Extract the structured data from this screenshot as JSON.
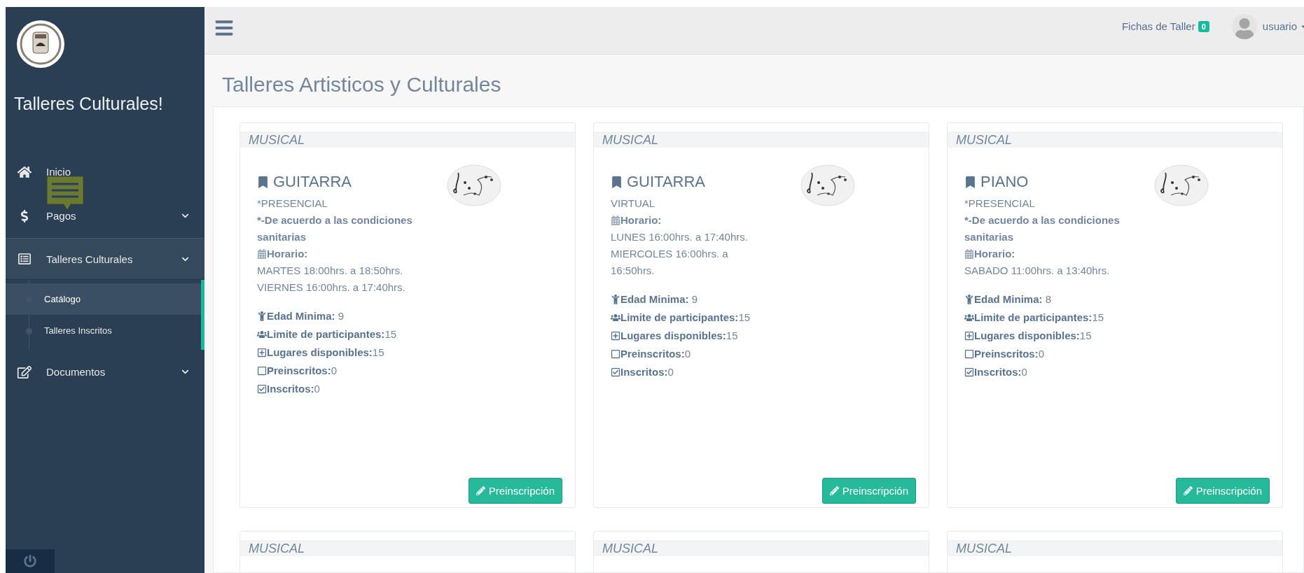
{
  "sidebar": {
    "brand": "Talleres Culturales!",
    "items": [
      {
        "kind": "link",
        "label": "Inicio",
        "expanded": false
      },
      {
        "kind": "menu",
        "label": "Pagos",
        "expanded": false,
        "tooltip": true
      },
      {
        "kind": "menu",
        "label": "Talleres Culturales",
        "expanded": true,
        "children": [
          {
            "label": "Catálogo",
            "selected": true
          },
          {
            "label": "Talleres Inscritos",
            "selected": false
          }
        ]
      },
      {
        "kind": "menu",
        "label": "Documentos",
        "expanded": false
      }
    ]
  },
  "topbar": {
    "fichas_label": "Fichas de Taller",
    "fichas_count": "0",
    "user": "usuario"
  },
  "page_title": "Talleres Artisticos y Culturales",
  "cards": [
    {
      "category": "MUSICAL",
      "title": "GUITARRA",
      "modality": "*PRESENCIAL",
      "note": "*-De acuerdo a las condiciones sanitarias",
      "schedule_label": "Horario:",
      "schedule": [
        "MARTES 18:00hrs. a 18:50hrs.",
        "VIERNES 16:00hrs. a 17:40hrs."
      ],
      "stats": [
        "**Edad Minima:** 9",
        "**Limite de participantes:**15",
        "**Lugares disponibles:**15",
        "**Preinscritos:**0",
        "**Inscritos:**0"
      ],
      "button": "Preinscripción"
    },
    {
      "category": "MUSICAL",
      "title": "GUITARRA",
      "modality": "VIRTUAL",
      "schedule_label": "Horario:",
      "schedule": [
        "LUNES 16:00hrs. a 17:40hrs.",
        "MIERCOLES 16:00hrs. a 16:50hrs."
      ],
      "stats": [
        "**Edad Minima:** 9",
        "**Limite de participantes:**15",
        "**Lugares disponibles:**15",
        "**Preinscritos:**0",
        "**Inscritos:**0"
      ],
      "button": "Preinscripción"
    },
    {
      "category": "MUSICAL",
      "title": "PIANO",
      "modality": "*PRESENCIAL",
      "note": "*-De acuerdo a las condiciones sanitarias",
      "schedule_label": "Horario:",
      "schedule": [
        "SABADO 11:00hrs. a 13:40hrs."
      ],
      "stats": [
        "**Edad Minima:** 8",
        "**Limite de participantes:**15",
        "**Lugares disponibles:**15",
        "**Preinscritos:**0",
        "**Inscritos:**0"
      ],
      "button": "Preinscripción"
    },
    {
      "category": "MUSICAL"
    },
    {
      "category": "MUSICAL"
    },
    {
      "category": "MUSICAL"
    }
  ]
}
